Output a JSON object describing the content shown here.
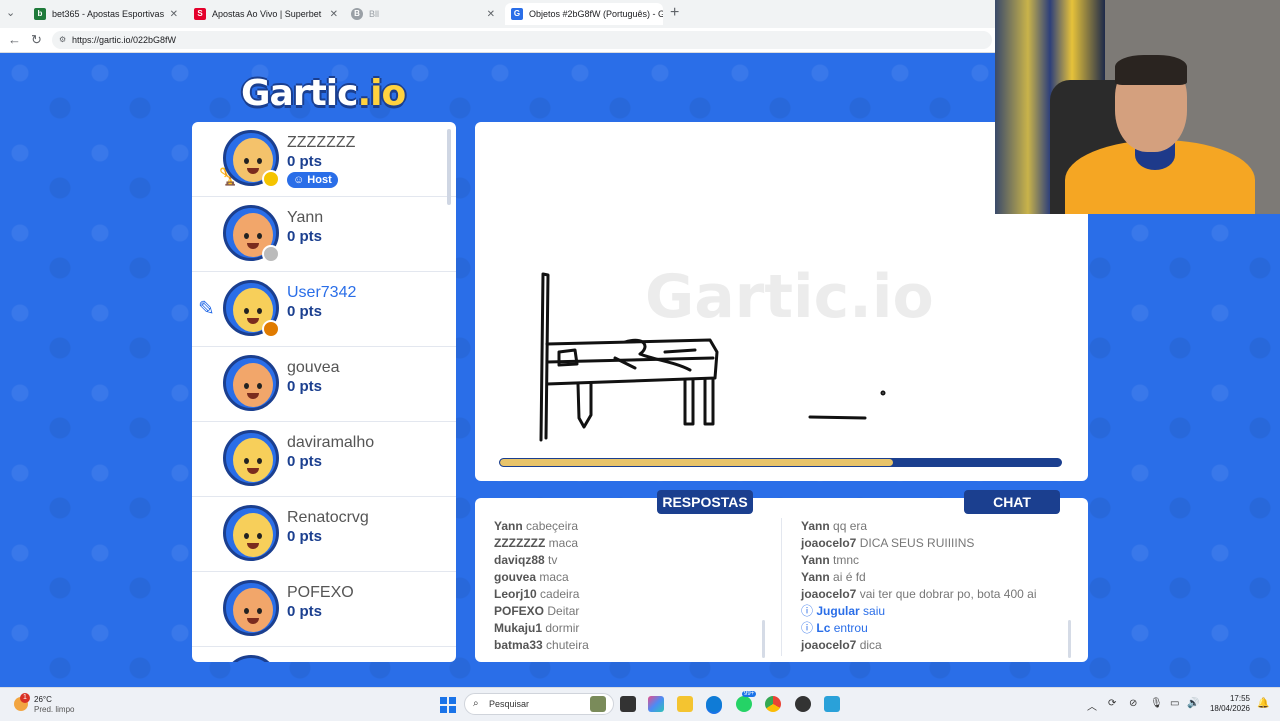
{
  "browser": {
    "tabs": [
      {
        "title": "bet365 - Apostas Esportivas Onlin",
        "favicon_color": "#1f7a3a",
        "favicon_letter": "b"
      },
      {
        "title": "Apostas Ao Vivo | Superbet",
        "favicon_color": "#e4002b",
        "favicon_letter": "S"
      },
      {
        "title": "Bll",
        "favicon_color": "#9aa0a6",
        "favicon_letter": "B"
      },
      {
        "title": "Objetos #2bG8fW (Português) - G",
        "favicon_color": "#2a6ee8",
        "favicon_letter": "G"
      }
    ],
    "url": "https://gartic.io/022bG8fW"
  },
  "game": {
    "logo_main": "Gartic",
    "logo_suffix": ".io",
    "watermark": "Gartic.io",
    "timer_remaining": 0.7,
    "players": [
      {
        "name": "ZZZZZZZ",
        "points": "0 pts",
        "host_label": "Host",
        "skin": "#f4c26b",
        "status_color": "#f5c400",
        "trophy": "1"
      },
      {
        "name": "Yann",
        "points": "0 pts",
        "skin": "#f2a66a",
        "status_color": "#bbbbbb"
      },
      {
        "name": "User7342",
        "points": "0 pts",
        "skin": "#f7cf5a",
        "status_color": "#e07b00",
        "drawing": true
      },
      {
        "name": "gouvea",
        "points": "0 pts",
        "skin": "#f2a66a"
      },
      {
        "name": "daviramalho",
        "points": "0 pts",
        "skin": "#f7cf5a"
      },
      {
        "name": "Renatocrvg",
        "points": "0 pts",
        "skin": "#f7cf5a"
      },
      {
        "name": "POFEXO",
        "points": "0 pts",
        "skin": "#f2a66a"
      }
    ],
    "answers_label": "RESPOSTAS",
    "chat_label": "CHAT",
    "answers": [
      {
        "user": "Yann",
        "text": "cabeçeira"
      },
      {
        "user": "ZZZZZZZ",
        "text": "maca"
      },
      {
        "user": "daviqz88",
        "text": "tv"
      },
      {
        "user": "gouvea",
        "text": "maca"
      },
      {
        "user": "Leorj10",
        "text": "cadeira"
      },
      {
        "user": "POFEXO",
        "text": "Deitar"
      },
      {
        "user": "Mukaju1",
        "text": "dormir"
      },
      {
        "user": "batma33",
        "text": "chuteira"
      }
    ],
    "chat": [
      {
        "user": "Yann",
        "text": "qq era"
      },
      {
        "user": "joaocelo7",
        "text": "DICA SEUS RUIIIINS"
      },
      {
        "user": "Yann",
        "text": "tmnc"
      },
      {
        "user": "Yann",
        "text": "ai é fd"
      },
      {
        "user": "joaocelo7",
        "text": "vai ter que dobrar po, bota 400 ai"
      },
      {
        "user": "Jugular",
        "text": "saiu",
        "system": true
      },
      {
        "user": "Lc",
        "text": "entrou",
        "system": true
      },
      {
        "user": "joaocelo7",
        "text": "dica"
      }
    ]
  },
  "taskbar": {
    "weather_temp": "26°C",
    "weather_desc": "Pred. limpo",
    "notification_count": "1",
    "search_placeholder": "Pesquisar",
    "time": "17:55",
    "date": "18/04/2026",
    "badge_count": "99+"
  }
}
